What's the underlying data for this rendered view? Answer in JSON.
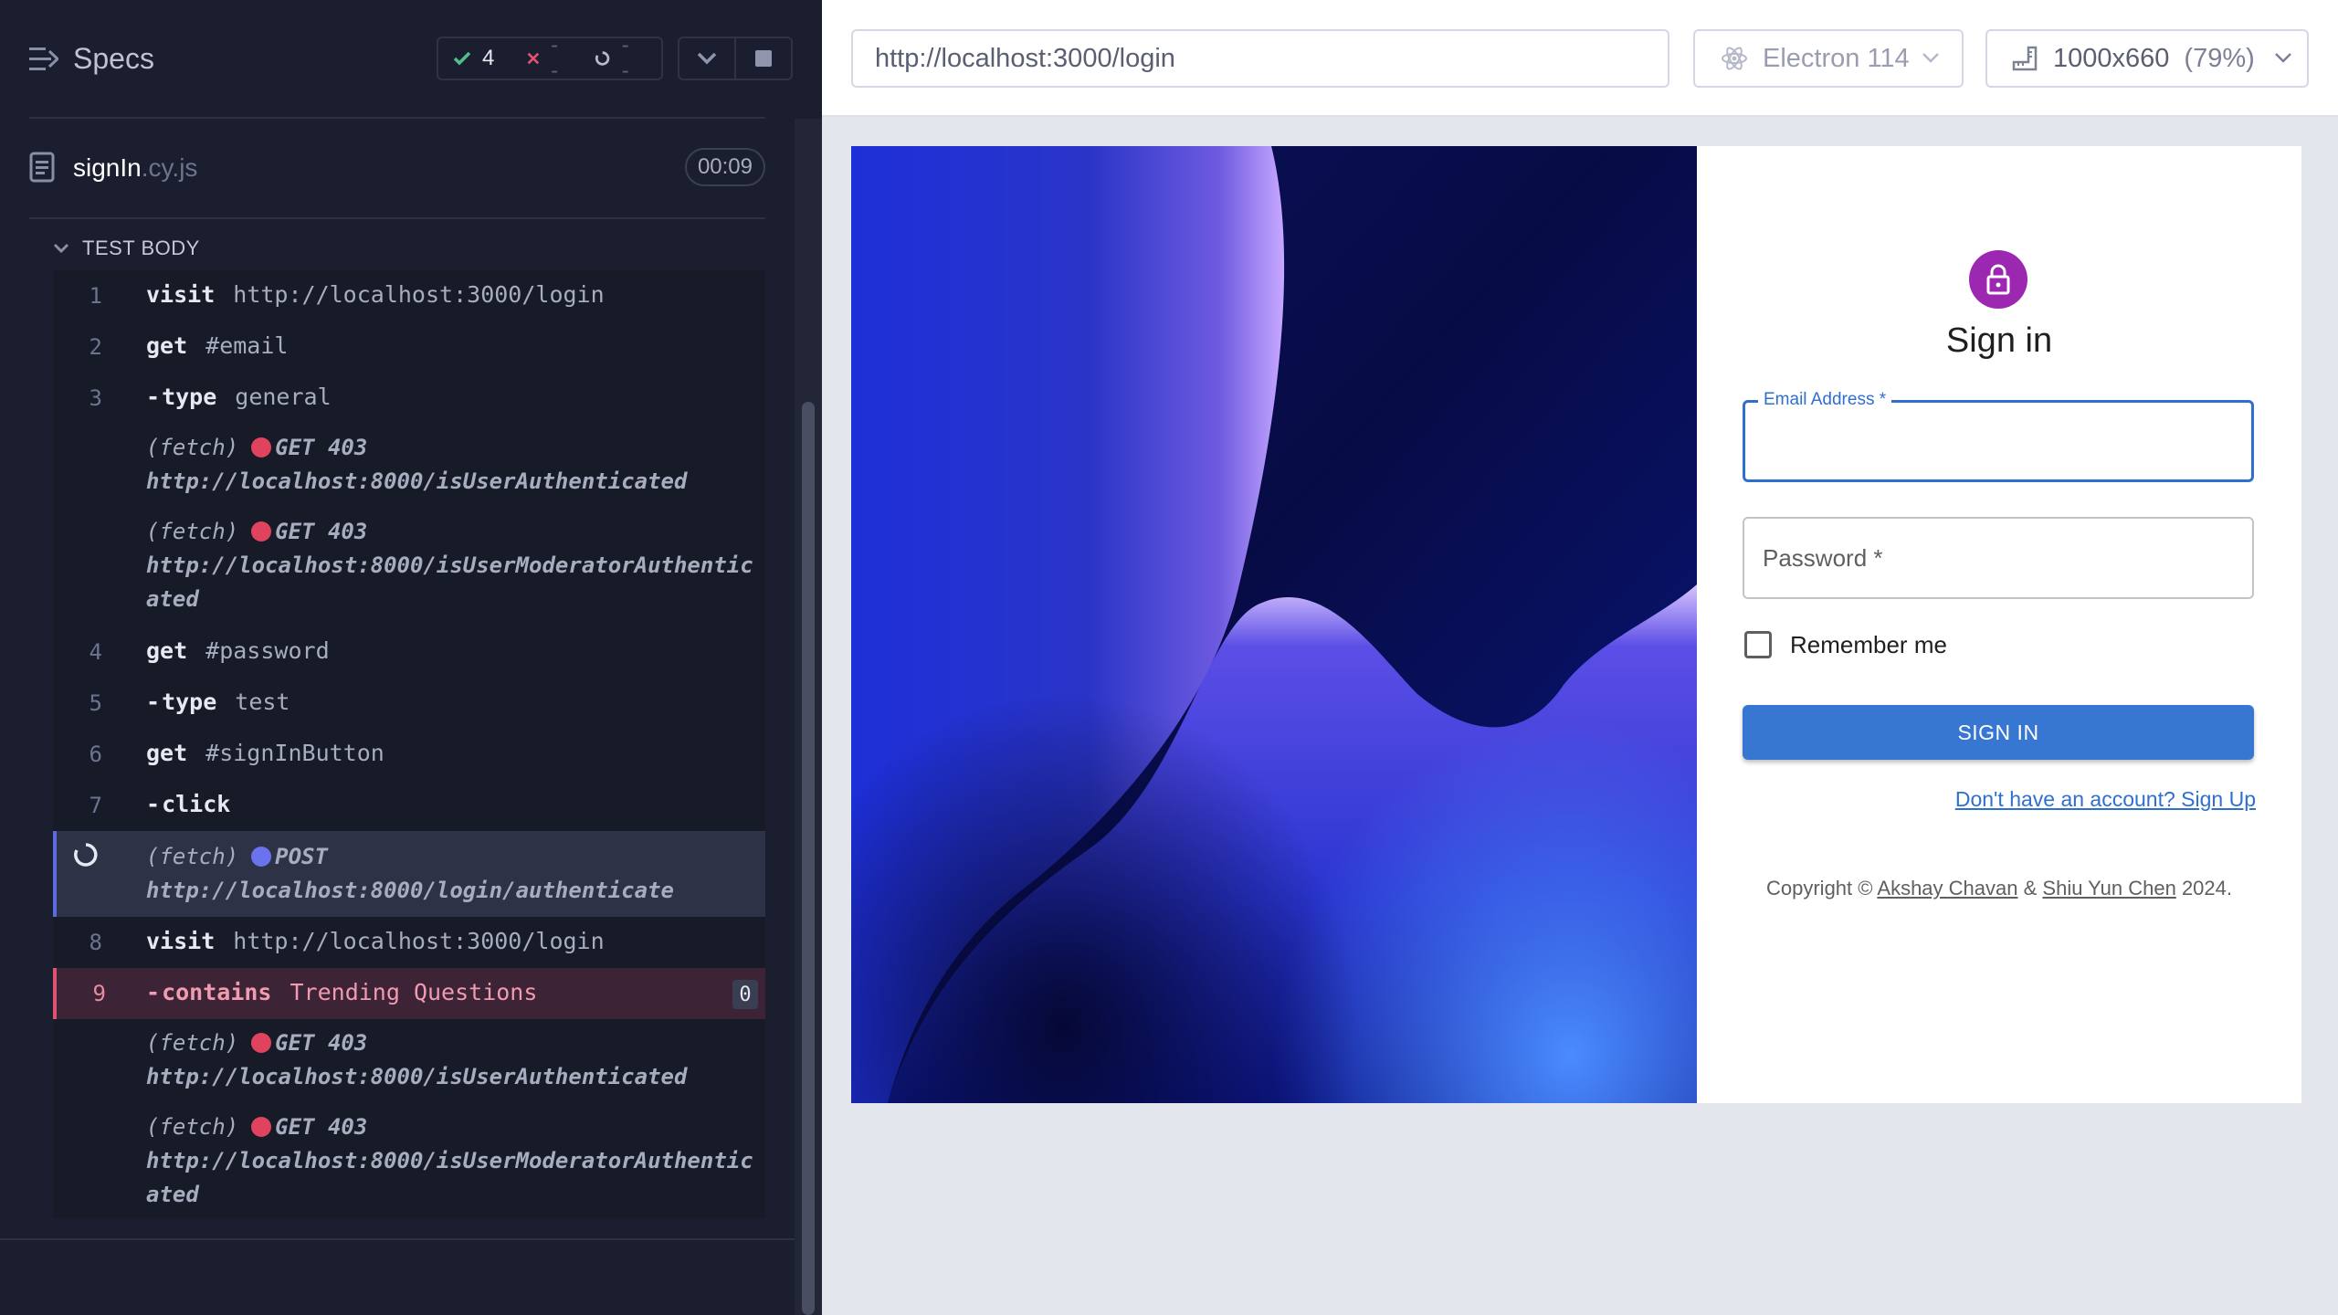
{
  "runner": {
    "title": "Specs",
    "stats": {
      "passed": "4",
      "failed": "--",
      "pending": "--"
    },
    "file": {
      "name": "signIn",
      "ext": ".cy.js",
      "duration": "00:09"
    },
    "section": "TEST BODY",
    "commands": {
      "c1": {
        "num": "1",
        "name": "visit",
        "arg": "http://localhost:3000/login"
      },
      "c2": {
        "num": "2",
        "name": "get",
        "arg": "#email"
      },
      "c3": {
        "num": "3",
        "name": "type",
        "arg": "general"
      },
      "f1": {
        "label": "(fetch)",
        "method": "GET 403",
        "url": "http://localhost:8000/isUserAuthenticated"
      },
      "f2": {
        "label": "(fetch)",
        "method": "GET 403",
        "url1": "http://localhost:8000/isUserModeratorAuthentic",
        "url2": "ated"
      },
      "c4": {
        "num": "4",
        "name": "get",
        "arg": "#password"
      },
      "c5": {
        "num": "5",
        "name": "type",
        "arg": "test"
      },
      "c6": {
        "num": "6",
        "name": "get",
        "arg": "#signInButton"
      },
      "c7": {
        "num": "7",
        "name": "click"
      },
      "f3": {
        "label": "(fetch)",
        "method": "POST",
        "url": "http://localhost:8000/login/authenticate"
      },
      "c8": {
        "num": "8",
        "name": "visit",
        "arg": "http://localhost:3000/login"
      },
      "c9": {
        "num": "9",
        "name": "contains",
        "arg": "Trending Questions",
        "badge": "0"
      },
      "f4": {
        "label": "(fetch)",
        "method": "GET 403",
        "url": "http://localhost:8000/isUserAuthenticated"
      },
      "f5": {
        "label": "(fetch)",
        "method": "GET 403",
        "url1": "http://localhost:8000/isUserModeratorAuthentic",
        "url2": "ated"
      }
    }
  },
  "aut": {
    "url": "http://localhost:3000/login",
    "browser": "Electron 114",
    "viewport": "1000x660",
    "scale": "(79%)"
  },
  "app": {
    "title": "Sign in",
    "email_label": "Email Address *",
    "password_label": "Password *",
    "remember_label": "Remember me",
    "signin_button": "SIGN IN",
    "signup_link": "Don't have an account? Sign Up",
    "copyright_prefix": "Copyright ©",
    "author1": "Akshay Chavan",
    "amp": "&",
    "author2": "Shiu Yun Chen",
    "year": "2024."
  },
  "colors": {
    "success": "#4fc08d",
    "fail": "#e05173",
    "fetch_error_dot": "#e0435e",
    "fetch_pending_dot": "#6a72ee",
    "accent": "#3777d2",
    "avatar": "#9c27b0"
  }
}
